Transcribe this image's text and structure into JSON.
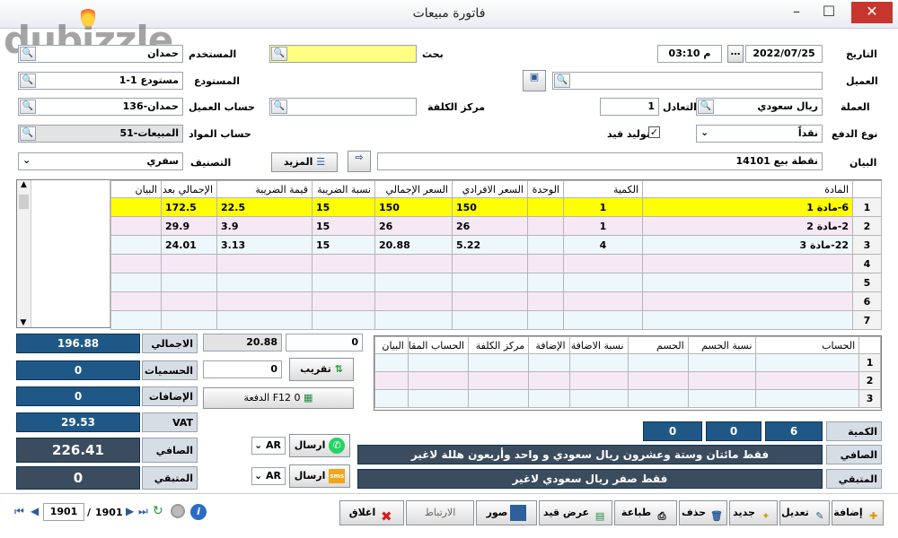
{
  "window": {
    "title": "فاتورة مبيعات",
    "logo_text": "dubizzle"
  },
  "form": {
    "date_label": "التاريخ",
    "date": "2022/07/25",
    "time": "03:10 م",
    "user_label": "المستخدم",
    "user": "حمدان",
    "search_label": "بحث",
    "customer_label": "العميل",
    "customer": "",
    "warehouse_label": "المستودع",
    "warehouse": "1-مستودع 1",
    "currency_label": "العملة",
    "currency": "ريال سعودي",
    "rate_label": "التعادل",
    "rate": "1",
    "cost_center_label": "مركز الكلفة",
    "cost_center": "",
    "customer_account_label": "حساب العميل",
    "customer_account": "136-حمدان",
    "payment_type_label": "نوع الدفع",
    "payment_type": "نقداً",
    "generate_entry_label": "توليد قيد",
    "generate_entry_checked": "✓",
    "materials_account_label": "حساب المواد",
    "materials_account": "51-المبيعات",
    "statement_label": "البيان",
    "statement": "نقطة بيع 14101",
    "more_label": "المزيد",
    "category_label": "التصنيف",
    "category": "سفري"
  },
  "items_table": {
    "headers": [
      "المادة",
      "الكمية",
      "الوحدة",
      "السعر الافرادي",
      "السعر الإجمالي",
      "نسبة الضريبة",
      "قيمة الضريبة",
      "الإجمالي بعد",
      "البيان"
    ],
    "rows": [
      {
        "num": "1",
        "item": "6-مادة 1",
        "qty": "1",
        "unit": "",
        "price": "150",
        "total": "150",
        "tax_rate": "15",
        "tax": "22.5",
        "grand": "172.5",
        "note": ""
      },
      {
        "num": "2",
        "item": "2-مادة 2",
        "qty": "1",
        "unit": "",
        "price": "26",
        "total": "26",
        "tax_rate": "15",
        "tax": "3.9",
        "grand": "29.9",
        "note": ""
      },
      {
        "num": "3",
        "item": "22-مادة 3",
        "qty": "4",
        "unit": "",
        "price": "5.22",
        "total": "20.88",
        "tax_rate": "15",
        "tax": "3.13",
        "grand": "24.01",
        "note": ""
      },
      {
        "num": "4"
      },
      {
        "num": "5"
      },
      {
        "num": "6"
      },
      {
        "num": "7"
      }
    ]
  },
  "summary": {
    "total_label": "الاجمالي",
    "total": "196.88",
    "discounts_label": "الحسميات",
    "discounts": "0",
    "additions_label": "الإضافات",
    "additions": "0",
    "vat_label": "VAT",
    "vat": "29.53",
    "net_label": "الصافي",
    "net": "226.41",
    "remaining_label": "المتبقي",
    "remaining": "0"
  },
  "payment": {
    "amount": "20.88",
    "zero": "0",
    "round_input": "0",
    "round_label": "تقريب",
    "payment_btn": "الدفعة F12 0"
  },
  "send": {
    "label": "ارسال",
    "lang": "AR"
  },
  "accounts_table": {
    "headers": [
      "الحساب",
      "نسبة الحسم",
      "الحسم",
      "نسبة الاضافة",
      "الإضافة",
      "مركز الكلفة",
      "الحساب المقا",
      "البيان"
    ],
    "rows": [
      "1",
      "2",
      "3"
    ]
  },
  "bottom_totals": {
    "qty_label": "الكمية",
    "qty1": "6",
    "qty2": "0",
    "qty3": "0",
    "net_label": "الصافي",
    "net_text": "فقط مائتان وستة وعشرون ريال سعودي و واحد وأربعون هللة لاغير",
    "remaining_label": "المتبقي",
    "remaining_text": "فقط صفر ريال سعودي لاغير"
  },
  "toolbar": {
    "add": "إضافة",
    "edit": "تعديل",
    "new": "جديد",
    "delete": "حذف",
    "print": "طباعة",
    "show_entry": "عرض قيد",
    "images": "صور",
    "link": "الارتباط",
    "close": "اغلاق"
  },
  "nav": {
    "current": "1901",
    "total": "1901",
    "separator": "/"
  }
}
